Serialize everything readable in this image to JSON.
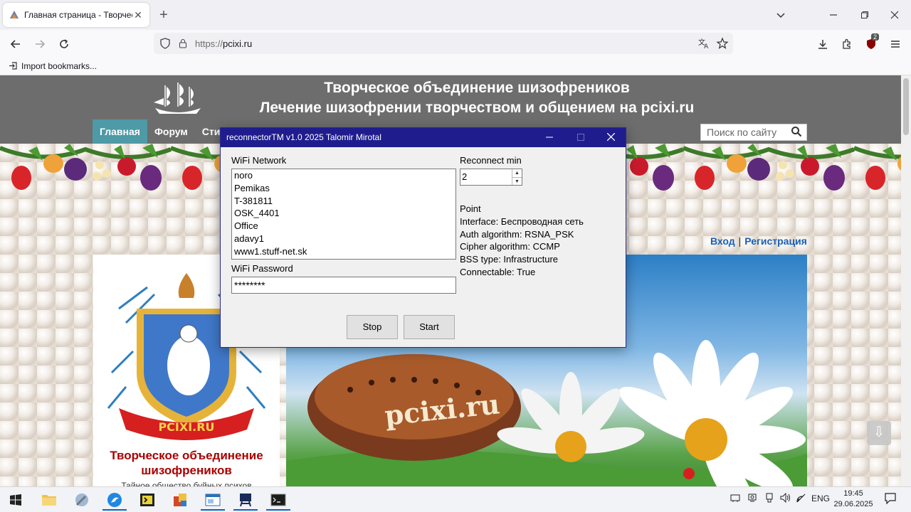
{
  "browser": {
    "tab_title": "Главная страница - Творческо",
    "url_scheme": "https://",
    "url_host": "pcixi.ru",
    "bookmarks_label": "Import bookmarks...",
    "extensions_badge": "2"
  },
  "site": {
    "title_line1": "Творческое объединение шизофреников",
    "title_line2": "Лечение шизофрении творчеством и общением на pcixi.ru",
    "menu": [
      "Главная",
      "Форум",
      "Сти"
    ],
    "search_placeholder": "Поиск по сайту",
    "login": "Вход",
    "register": "Регистрация",
    "emblem_banner": "PCIXI.RU",
    "card_title": "Творческое объединение шизофреников",
    "card_subtitle": "Тайное общество буйных психов",
    "hero_text": "pcixi.ru"
  },
  "dialog": {
    "title": "reconnectorTM v1.0 2025 Talomir Mirotal",
    "wifi_network_label": "WiFi Network",
    "networks": [
      "noro",
      "Pemikas",
      "T-381811",
      "OSK_4401",
      "Office",
      "adavy1",
      "www1.stuff-net.sk"
    ],
    "wifi_password_label": "WiFi Password",
    "wifi_password_value": "********",
    "reconnect_label": "Reconnect min",
    "reconnect_value": "2",
    "info": {
      "point": "Point",
      "interface": "Interface: Беспроводная сеть",
      "auth": "Auth algorithm: RSNA_PSK",
      "cipher": "Cipher algorithm: CCMP",
      "bss": "BSS type: Infrastructure",
      "connectable": "Connectable: True"
    },
    "stop_label": "Stop",
    "start_label": "Start"
  },
  "taskbar": {
    "lang": "ENG",
    "time": "19:45",
    "date": "29.06.2025"
  }
}
